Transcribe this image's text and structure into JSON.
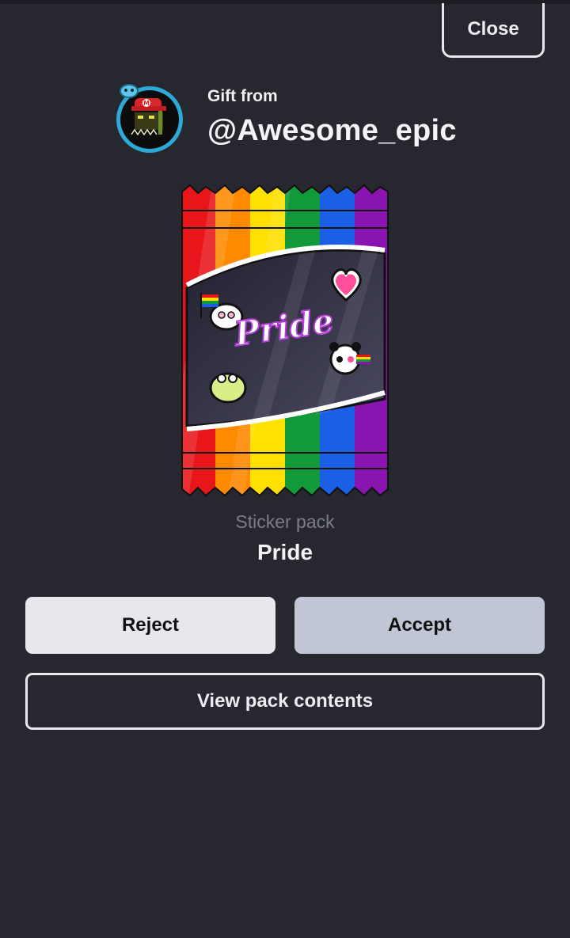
{
  "header": {
    "close_label": "Close"
  },
  "gift": {
    "from_label": "Gift from",
    "username": "@Awesome_epic"
  },
  "pack": {
    "type": "Sticker pack",
    "name": "Pride",
    "logo_text": "Pride"
  },
  "actions": {
    "reject_label": "Reject",
    "accept_label": "Accept",
    "view_label": "View pack contents"
  },
  "colors": {
    "background": "#26272f",
    "accept": "#c0c6d6",
    "reject": "#e7e8ee",
    "rainbow": [
      "#e8161b",
      "#ff8a00",
      "#ffe000",
      "#129a3a",
      "#1a5fe6",
      "#8a14b0"
    ]
  },
  "icons": {
    "avatar": "avatar-icon",
    "stickers": [
      "heart-icon",
      "ghost-icon",
      "frog-icon",
      "panda-icon",
      "pride-flag-icon"
    ]
  }
}
